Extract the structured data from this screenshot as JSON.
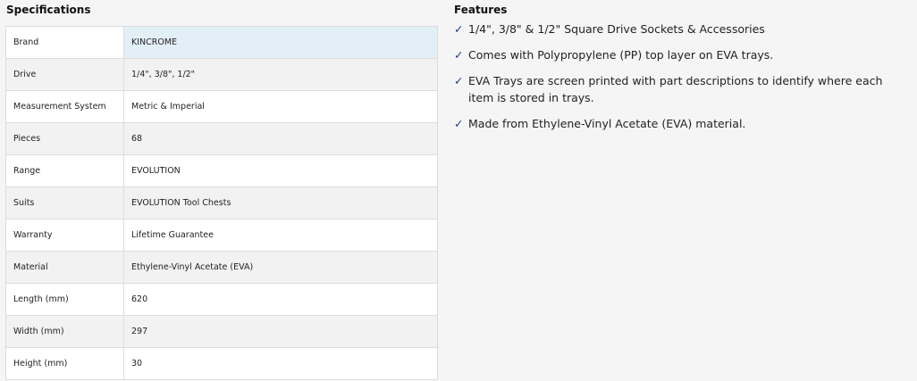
{
  "specifications": {
    "title": "Specifications",
    "rows": [
      {
        "label": "Brand",
        "value": "KINCROME"
      },
      {
        "label": "Drive",
        "value": "1/4\", 3/8\", 1/2\""
      },
      {
        "label": "Measurement System",
        "value": "Metric & Imperial"
      },
      {
        "label": "Pieces",
        "value": "68"
      },
      {
        "label": "Range",
        "value": "EVOLUTION"
      },
      {
        "label": "Suits",
        "value": "EVOLUTION Tool Chests"
      },
      {
        "label": "Warranty",
        "value": "Lifetime Guarantee"
      },
      {
        "label": "Material",
        "value": "Ethylene-Vinyl Acetate (EVA)"
      },
      {
        "label": "Length (mm)",
        "value": "620"
      },
      {
        "label": "Width (mm)",
        "value": "297"
      },
      {
        "label": "Height (mm)",
        "value": "30"
      }
    ]
  },
  "features": {
    "title": "Features",
    "check_icon": "✓",
    "check_color": "#1a3c8c",
    "items": [
      "1/4\", 3/8\" & 1/2\" Square Drive Sockets & Accessories",
      "Comes with Polypropylene (PP) top layer on EVA trays.",
      "EVA Trays are screen printed with part descriptions to identify where each item is stored in trays.",
      "Made from Ethylene-Vinyl Acetate (EVA) material."
    ]
  }
}
